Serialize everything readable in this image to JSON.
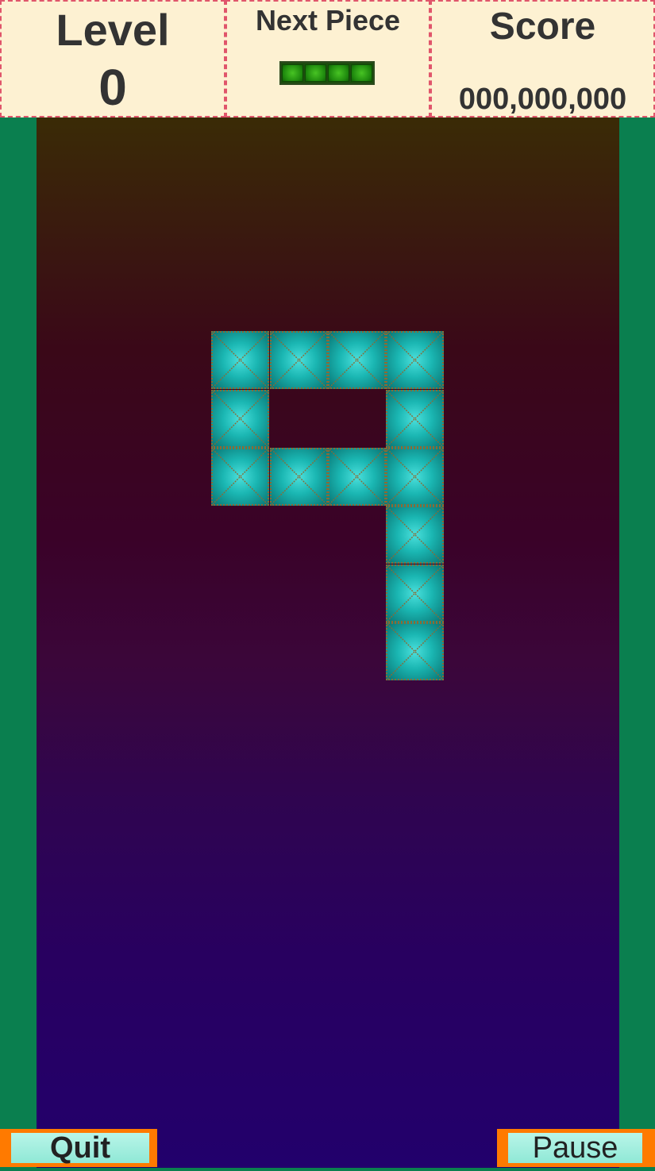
{
  "hud": {
    "level_label": "Level",
    "level_value": "0",
    "next_piece_label": "Next Piece",
    "score_label": "Score",
    "score_value": "000,000,000"
  },
  "next_piece": {
    "shape": "I",
    "color": "#2f9a18",
    "cells": 4
  },
  "board": {
    "columns": 10,
    "gradient_top": "#3a2b06",
    "gradient_bottom": "#22006c",
    "block_color": "#1ab6b2",
    "filled_cells": [
      [
        3,
        3
      ],
      [
        4,
        3
      ],
      [
        5,
        3
      ],
      [
        6,
        3
      ],
      [
        3,
        4
      ],
      [
        6,
        4
      ],
      [
        3,
        5
      ],
      [
        4,
        5
      ],
      [
        5,
        5
      ],
      [
        6,
        5
      ],
      [
        6,
        6
      ],
      [
        6,
        7
      ],
      [
        6,
        8
      ]
    ]
  },
  "buttons": {
    "quit_label": "Quit",
    "pause_label": "Pause"
  },
  "colors": {
    "side_panel": "#0a7f4f",
    "hud_background": "#fdf1d2",
    "hud_border": "#e0556b",
    "button_frame": "#ff7a00",
    "button_face": "#a6efdf"
  }
}
